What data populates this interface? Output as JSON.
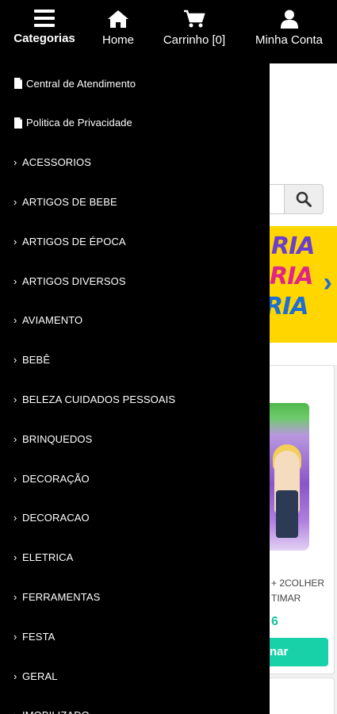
{
  "nav": {
    "categories_label": "Categorias",
    "home_label": "Home",
    "cart_label": "Carrinho [0]",
    "account_label": "Minha Conta"
  },
  "drawer": {
    "items": [
      {
        "label": "Central de Atendimento",
        "icon": "document-icon"
      },
      {
        "label": "Politica de Privacidade",
        "icon": "document-icon"
      },
      {
        "label": "ACESSORIOS",
        "icon": "chevron-right-icon"
      },
      {
        "label": "ARTIGOS DE BEBE",
        "icon": "chevron-right-icon"
      },
      {
        "label": "ARTIGOS DE ÉPOCA",
        "icon": "chevron-right-icon"
      },
      {
        "label": "ARTIGOS DIVERSOS",
        "icon": "chevron-right-icon"
      },
      {
        "label": "AVIAMENTO",
        "icon": "chevron-right-icon"
      },
      {
        "label": "BEBÊ",
        "icon": "chevron-right-icon"
      },
      {
        "label": "BELEZA CUIDADOS PESSOAIS",
        "icon": "chevron-right-icon"
      },
      {
        "label": "BRINQUEDOS",
        "icon": "chevron-right-icon"
      },
      {
        "label": "DECORAÇÃO",
        "icon": "chevron-right-icon"
      },
      {
        "label": "DECORACAO",
        "icon": "chevron-right-icon"
      },
      {
        "label": "ELETRICA",
        "icon": "chevron-right-icon"
      },
      {
        "label": "FERRAMENTAS",
        "icon": "chevron-right-icon"
      },
      {
        "label": "FESTA",
        "icon": "chevron-right-icon"
      },
      {
        "label": "GERAL",
        "icon": "chevron-right-icon"
      },
      {
        "label": "IMOBILIZADO",
        "icon": "chevron-right-icon"
      }
    ]
  },
  "background": {
    "banner_lines": [
      "RIA",
      "RIA",
      "RIA"
    ],
    "product_name_line1": "+ 2COLHER",
    "product_name_line2": "TIMAR",
    "product_price": "6",
    "buy_label": "nar"
  },
  "colors": {
    "nav_bg": "#000000",
    "drawer_bg": "#000000",
    "accent": "#19d1a8",
    "banner": "#ffd600"
  }
}
